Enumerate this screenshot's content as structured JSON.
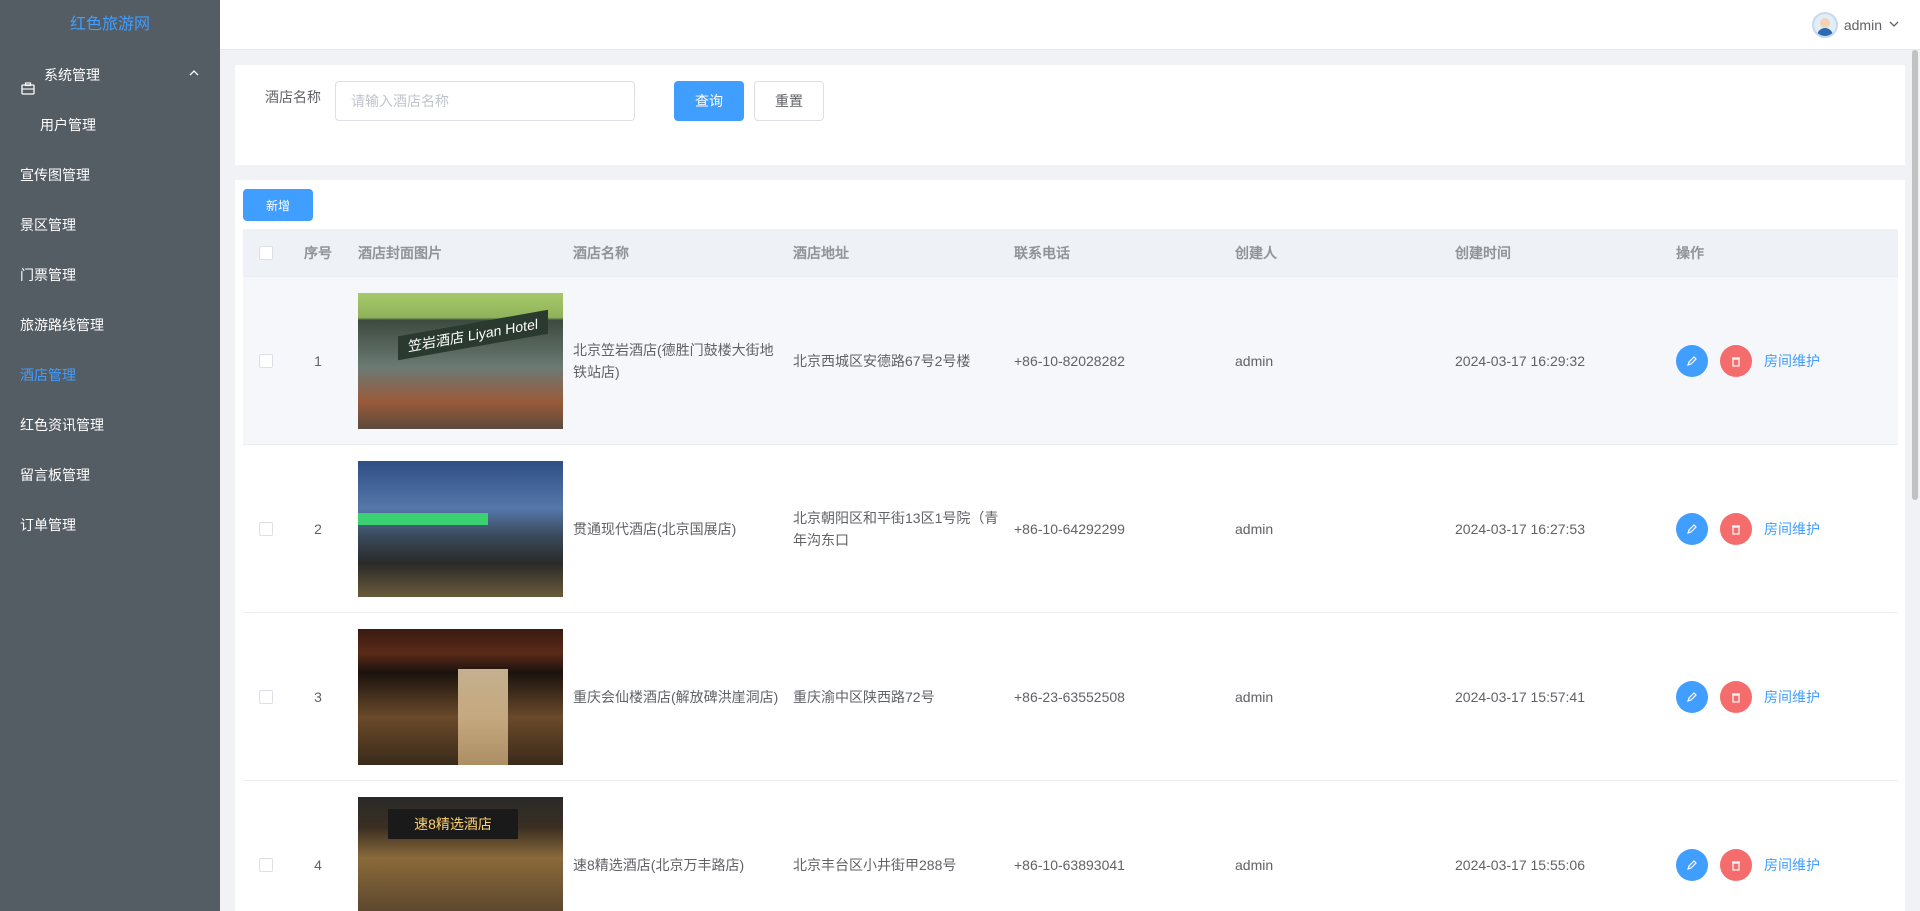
{
  "app": {
    "title": "红色旅游网"
  },
  "sidebar": {
    "items": [
      {
        "label": "系统管理"
      },
      {
        "label": "用户管理"
      },
      {
        "label": "宣传图管理"
      },
      {
        "label": "景区管理"
      },
      {
        "label": "门票管理"
      },
      {
        "label": "旅游路线管理"
      },
      {
        "label": "酒店管理"
      },
      {
        "label": "红色资讯管理"
      },
      {
        "label": "留言板管理"
      },
      {
        "label": "订单管理"
      }
    ]
  },
  "header": {
    "username": "admin"
  },
  "search": {
    "label": "酒店名称",
    "placeholder": "请输入酒店名称",
    "search_button": "查询",
    "reset_button": "重置"
  },
  "toolbar": {
    "add_button": "新增"
  },
  "table": {
    "columns": [
      "序号",
      "酒店封面图片",
      "酒店名称",
      "酒店地址",
      "联系电话",
      "创建人",
      "创建时间",
      "操作"
    ],
    "rows": [
      {
        "index": "1",
        "name": "北京笠岩酒店(德胜门鼓楼大街地铁站店)",
        "address": "北京西城区安德路67号2号楼",
        "phone": "+86-10-82028282",
        "creator": "admin",
        "created": "2024-03-17 16:29:32",
        "action": "房间维护",
        "img_sign": "笠岩酒店 Liyan Hotel"
      },
      {
        "index": "2",
        "name": "贯通现代酒店(北京国展店)",
        "address": "北京朝阳区和平街13区1号院（青年沟东口",
        "phone": "+86-10-64292299",
        "creator": "admin",
        "created": "2024-03-17 16:27:53",
        "action": "房间维护"
      },
      {
        "index": "3",
        "name": "重庆会仙楼酒店(解放碑洪崖洞店)",
        "address": "重庆渝中区陕西路72号",
        "phone": "+86-23-63552508",
        "creator": "admin",
        "created": "2024-03-17 15:57:41",
        "action": "房间维护"
      },
      {
        "index": "4",
        "name": "速8精选酒店(北京万丰路店)",
        "address": "北京丰台区小井街甲288号",
        "phone": "+86-10-63893041",
        "creator": "admin",
        "created": "2024-03-17 15:55:06",
        "action": "房间维护",
        "img_sign": "速8精选酒店"
      }
    ]
  }
}
